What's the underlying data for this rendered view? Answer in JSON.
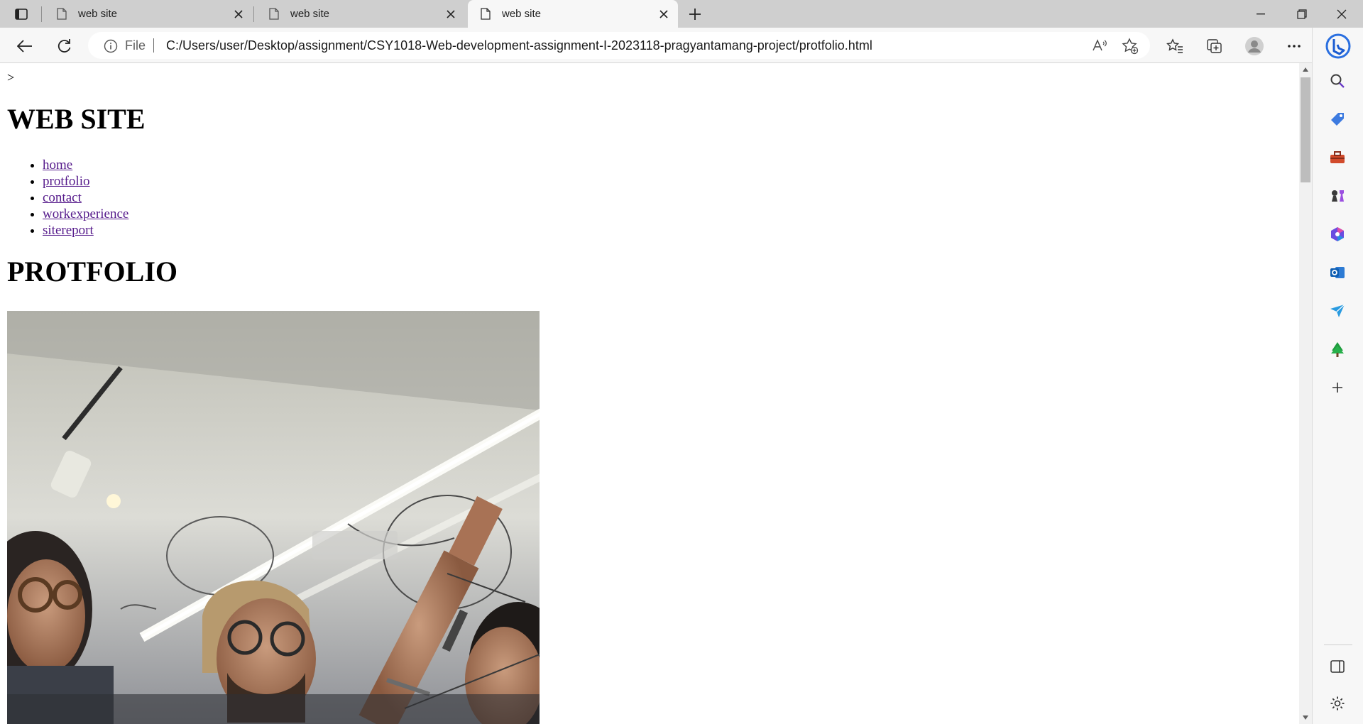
{
  "browser": {
    "tabs": [
      {
        "title": "web site",
        "active": false
      },
      {
        "title": "web site",
        "active": false
      },
      {
        "title": "web site",
        "active": true
      }
    ],
    "address": {
      "scheme_label": "File",
      "url": "C:/Users/user/Desktop/assignment/CSY1018-Web-development-assignment-I-2023118-pragyantamang-project/protfolio.html"
    },
    "accent_color": "#1a73e8"
  },
  "page": {
    "stray_text": ">",
    "site_title": "WEB SITE",
    "nav": [
      {
        "label": "home"
      },
      {
        "label": "protfolio"
      },
      {
        "label": "contact"
      },
      {
        "label": "workexperience"
      },
      {
        "label": "sitereport"
      }
    ],
    "heading": "PROTFOLIO",
    "link_color": "#551a8b"
  },
  "sidebar": {
    "icons": [
      "search-icon",
      "tag-icon",
      "toolbox-icon",
      "chess-icon",
      "office-icon",
      "outlook-icon",
      "send-icon",
      "tree-icon",
      "add-icon",
      "split-screen-icon",
      "settings-icon"
    ]
  }
}
